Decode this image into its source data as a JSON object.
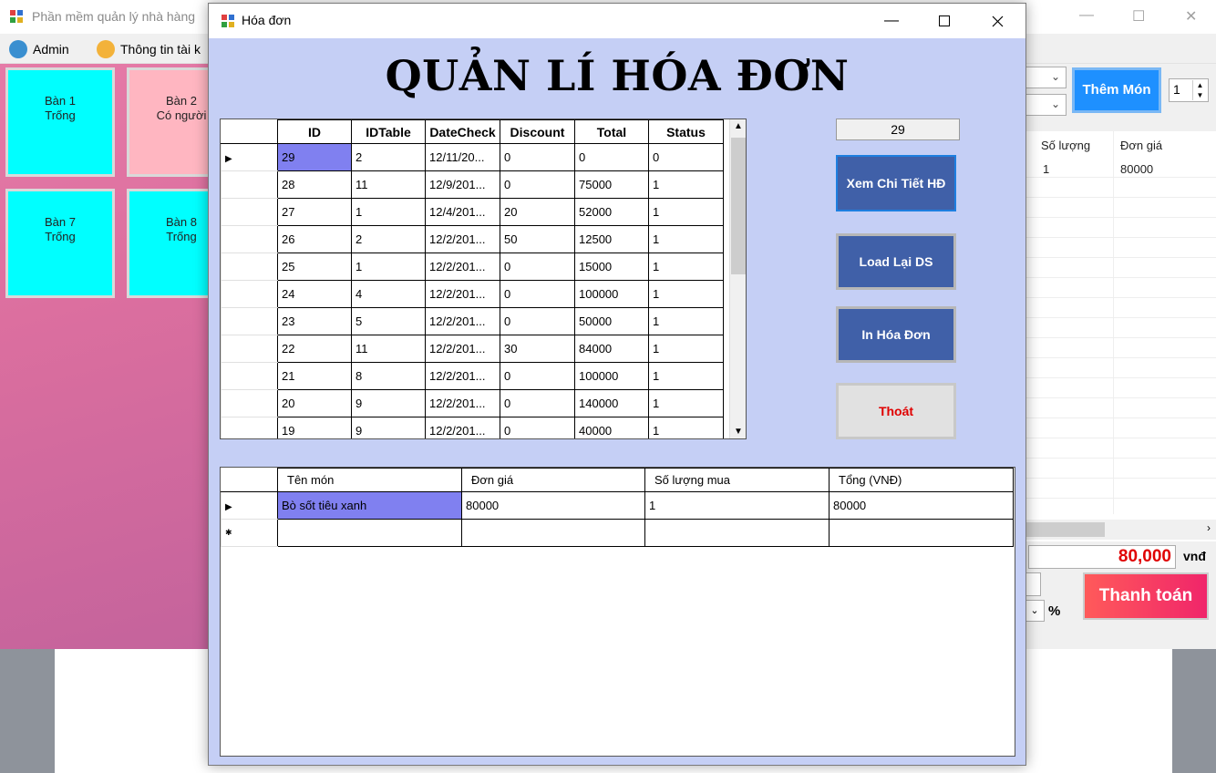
{
  "main_window": {
    "title": "Phần mềm quản lý nhà hàng",
    "menu": [
      {
        "label": "Admin",
        "icon": "admin-icon"
      },
      {
        "label": "Thông tin tài k",
        "icon": "user-icon"
      }
    ],
    "tables": [
      {
        "name": "Bàn 1",
        "status": "Trống",
        "color": "#00ffff"
      },
      {
        "name": "Bàn 2",
        "status": "Có người",
        "color": "#ffb6c1"
      },
      {
        "name": "Bàn 7",
        "status": "Trống",
        "color": "#00ffff"
      },
      {
        "name": "Bàn 8",
        "status": "Trống",
        "color": "#00ffff"
      }
    ],
    "add_food_label": "Thêm Món",
    "qty_value": "1",
    "bill_columns": [
      "Số lượng",
      "Đơn giá"
    ],
    "bill_row": [
      "1",
      "80000"
    ],
    "total": "80,000",
    "currency": "vnđ",
    "pay_label": "Thanh toán",
    "percent": "%"
  },
  "dialog": {
    "title": "Hóa đơn",
    "heading": "QUẢN LÍ HÓA ĐƠN",
    "selected_id": "29",
    "buttons": {
      "view_detail": "Xem Chi Tiết HĐ",
      "reload": "Load Lại DS",
      "print": "In Hóa Đơn",
      "exit": "Thoát"
    },
    "invoice_grid": {
      "columns": [
        "ID",
        "IDTable",
        "DateCheck",
        "Discount",
        "Total",
        "Status"
      ],
      "rows": [
        [
          "29",
          "2",
          "12/11/20...",
          "0",
          "0",
          "0"
        ],
        [
          "28",
          "11",
          "12/9/201...",
          "0",
          "75000",
          "1"
        ],
        [
          "27",
          "1",
          "12/4/201...",
          "20",
          "52000",
          "1"
        ],
        [
          "26",
          "2",
          "12/2/201...",
          "50",
          "12500",
          "1"
        ],
        [
          "25",
          "1",
          "12/2/201...",
          "0",
          "15000",
          "1"
        ],
        [
          "24",
          "4",
          "12/2/201...",
          "0",
          "100000",
          "1"
        ],
        [
          "23",
          "5",
          "12/2/201...",
          "0",
          "50000",
          "1"
        ],
        [
          "22",
          "11",
          "12/2/201...",
          "30",
          "84000",
          "1"
        ],
        [
          "21",
          "8",
          "12/2/201...",
          "0",
          "100000",
          "1"
        ],
        [
          "20",
          "9",
          "12/2/201...",
          "0",
          "140000",
          "1"
        ],
        [
          "19",
          "9",
          "12/2/201...",
          "0",
          "40000",
          "1"
        ]
      ]
    },
    "detail_grid": {
      "columns": [
        "Tên món",
        "Đơn giá",
        "Số lượng mua",
        "Tổng (VNĐ)"
      ],
      "rows": [
        [
          "Bò sốt tiêu xanh",
          "80000",
          "1",
          "80000"
        ]
      ]
    }
  }
}
